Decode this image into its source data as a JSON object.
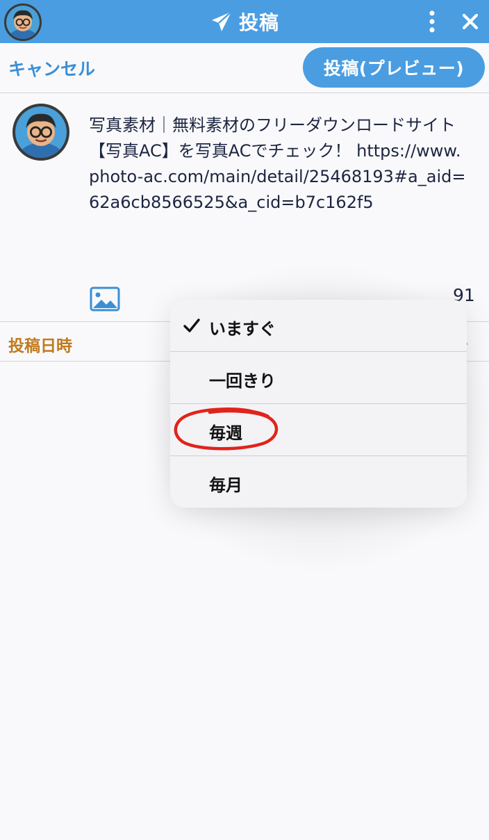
{
  "header": {
    "title": "投稿"
  },
  "toolbar": {
    "cancel_label": "キャンセル",
    "preview_label": "投稿(プレビュー)"
  },
  "compose": {
    "text": "写真素材｜無料素材のフリーダウンロードサイト【写真AC】を写真ACでチェック！ https://www.photo-ac.com/main/detail/25468193#a_aid=62a6cb8566525&a_cid=b7c162f5",
    "char_count": "91"
  },
  "schedule": {
    "label": "投稿日時"
  },
  "menu": {
    "items": [
      {
        "label": "いますぐ",
        "checked": true
      },
      {
        "label": "一回きり",
        "checked": false
      },
      {
        "label": "毎週",
        "checked": false
      },
      {
        "label": "毎月",
        "checked": false
      }
    ]
  },
  "colors": {
    "header_bg": "#4a9de1",
    "accent_blue": "#3a8fd6",
    "schedule_label": "#c07a1c",
    "annotation_red": "#e0241b"
  },
  "icons": {
    "send": "send-icon",
    "more": "more-vertical-icon",
    "close": "close-icon",
    "image": "image-icon",
    "check": "checkmark-icon"
  }
}
